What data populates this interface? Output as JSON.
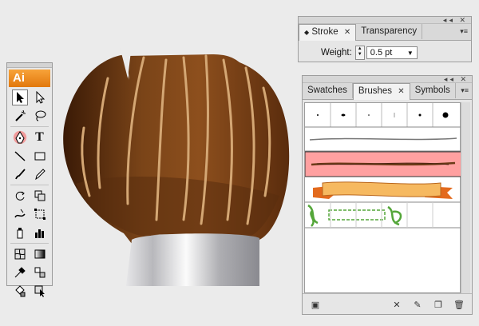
{
  "tools_panel": {
    "logo": "Ai",
    "tools": [
      [
        "selection-tool",
        "direct-selection-tool"
      ],
      [
        "magic-wand-tool",
        "lasso-tool"
      ],
      [
        "pen-tool",
        "type-tool"
      ],
      [
        "line-segment-tool",
        "rectangle-tool"
      ],
      [
        "paintbrush-tool",
        "pencil-tool"
      ],
      [
        "rotate-tool",
        "scale-tool"
      ],
      [
        "warp-tool",
        "free-transform-tool"
      ],
      [
        "symbol-sprayer-tool",
        "column-graph-tool"
      ],
      [
        "mesh-tool",
        "gradient-tool"
      ],
      [
        "eyedropper-tool",
        "blend-tool"
      ],
      [
        "live-paint-bucket-tool",
        "live-paint-selection-tool"
      ]
    ],
    "type_glyph": "T"
  },
  "stroke_panel": {
    "tabs": [
      {
        "label": "Stroke",
        "active": true,
        "closable": true
      },
      {
        "label": "Transparency",
        "active": false,
        "closable": false
      }
    ],
    "weight_label": "Weight:",
    "weight_value": "0.5 pt"
  },
  "brushes_panel": {
    "tabs": [
      {
        "label": "Swatches",
        "active": false,
        "closable": false
      },
      {
        "label": "Brushes",
        "active": true,
        "closable": true
      },
      {
        "label": "Symbols",
        "active": false,
        "closable": false
      }
    ],
    "selected_brush_row": 3,
    "footer_icons": [
      "brush-libraries-icon",
      "remove-brush-stroke-icon",
      "brush-options-icon",
      "new-brush-icon",
      "delete-brush-icon"
    ]
  },
  "colors": {
    "accent_orange": "#e8830f",
    "selection_pink": "#ffa0a0",
    "brush_brown": "#6b3a17"
  },
  "glyphs": {
    "close": "✕",
    "dropdown": "▼",
    "collapse": "◂◂",
    "menu": "▾≡",
    "spin_up": "▲",
    "spin_down": "▼"
  }
}
